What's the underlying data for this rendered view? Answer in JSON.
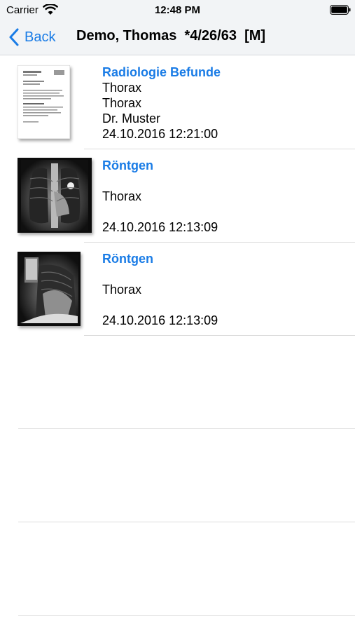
{
  "status_bar": {
    "carrier": "Carrier",
    "time": "12:48 PM"
  },
  "nav": {
    "back_label": "Back",
    "title": "Demo, Thomas  *4/26/63  [M]"
  },
  "items": [
    {
      "title": "Radiologie Befunde",
      "line1": "Thorax",
      "line2": "Thorax",
      "line3": "Dr. Muster",
      "date": "24.10.2016 12:21:00",
      "thumbnail": "document-thumbnail"
    },
    {
      "title": "Röntgen",
      "line1": "",
      "line2": "Thorax",
      "line3": "",
      "date": "24.10.2016 12:13:09",
      "thumbnail": "xray-frontal-thumbnail"
    },
    {
      "title": "Röntgen",
      "line1": "",
      "line2": "Thorax",
      "line3": "",
      "date": "24.10.2016 12:13:09",
      "thumbnail": "xray-lateral-thumbnail"
    }
  ],
  "colors": {
    "accent": "#1a7ce6",
    "bar_background": "#f2f4f6",
    "separator": "#dcdcdc"
  }
}
